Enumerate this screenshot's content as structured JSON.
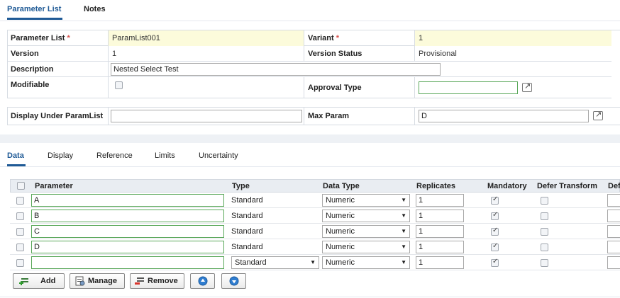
{
  "top_tabs": [
    {
      "label": "Parameter List",
      "active": true
    },
    {
      "label": "Notes",
      "active": false
    }
  ],
  "form": {
    "param_list_label": "Parameter List",
    "param_list_required": "*",
    "param_list_value": "ParamList001",
    "variant_label": "Variant",
    "variant_required": "*",
    "variant_value": "1",
    "version_label": "Version",
    "version_value": "1",
    "version_status_label": "Version Status",
    "version_status_value": "Provisional",
    "description_label": "Description",
    "description_value": "Nested Select Test",
    "modifiable_label": "Modifiable",
    "modifiable_checked": false,
    "approval_type_label": "Approval Type",
    "approval_type_value": "",
    "display_under_label": "Display Under ParamList",
    "display_under_value": "",
    "max_param_label": "Max Param",
    "max_param_value": "D"
  },
  "sub_tabs": [
    {
      "label": "Data",
      "active": true
    },
    {
      "label": "Display",
      "active": false
    },
    {
      "label": "Reference",
      "active": false
    },
    {
      "label": "Limits",
      "active": false
    },
    {
      "label": "Uncertainty",
      "active": false
    }
  ],
  "grid": {
    "headers": {
      "parameter": "Parameter",
      "type": "Type",
      "data_type": "Data Type",
      "replicates": "Replicates",
      "mandatory": "Mandatory",
      "defer_transform": "Defer Transform",
      "def": "Def"
    },
    "rows": [
      {
        "parameter": "A",
        "type": "Standard",
        "type_is_select": false,
        "data_type": "Numeric",
        "replicates": "1",
        "mandatory": true,
        "defer_transform": false
      },
      {
        "parameter": "B",
        "type": "Standard",
        "type_is_select": false,
        "data_type": "Numeric",
        "replicates": "1",
        "mandatory": true,
        "defer_transform": false
      },
      {
        "parameter": "C",
        "type": "Standard",
        "type_is_select": false,
        "data_type": "Numeric",
        "replicates": "1",
        "mandatory": true,
        "defer_transform": false
      },
      {
        "parameter": "D",
        "type": "Standard",
        "type_is_select": false,
        "data_type": "Numeric",
        "replicates": "1",
        "mandatory": true,
        "defer_transform": false
      },
      {
        "parameter": "",
        "type": "Standard",
        "type_is_select": true,
        "data_type": "Numeric",
        "replicates": "1",
        "mandatory": true,
        "defer_transform": false
      }
    ]
  },
  "buttons": {
    "add": "Add",
    "manage": "Manage",
    "remove": "Remove"
  },
  "colors": {
    "accent": "#1f5a96",
    "required": "#d9534f",
    "highlight_field": "#fcfbdb",
    "input_green_border": "#5aa85a"
  }
}
